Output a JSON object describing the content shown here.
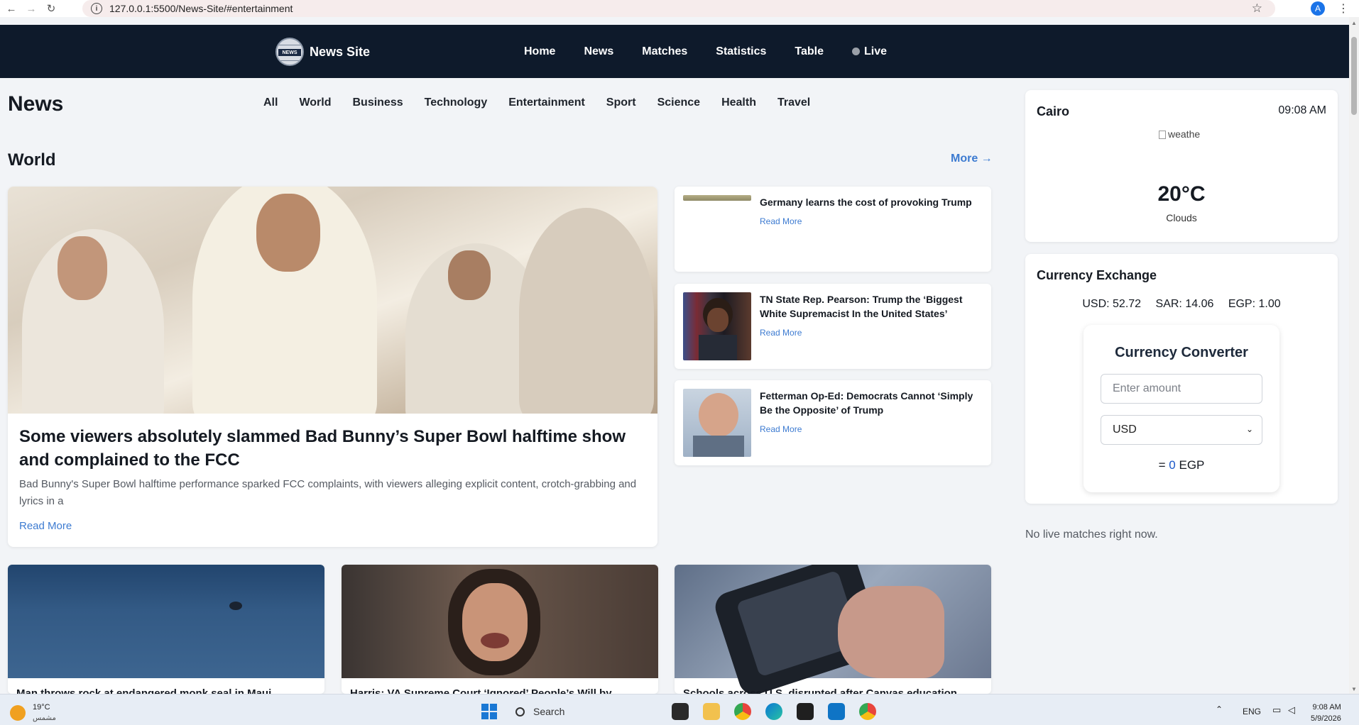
{
  "browser": {
    "url": "127.0.0.1:5500/News-Site/#entertainment",
    "profile_initial": "A"
  },
  "header": {
    "brand": "News Site",
    "logo_badge": "NEWS",
    "nav": [
      "Home",
      "News",
      "Matches",
      "Statistics",
      "Table",
      "Live"
    ]
  },
  "page": {
    "title": "News",
    "categories": [
      "All",
      "World",
      "Business",
      "Technology",
      "Entertainment",
      "Sport",
      "Science",
      "Health",
      "Travel"
    ],
    "section_title": "World",
    "more_label": "More →"
  },
  "featured": {
    "title": "Some viewers absolutely slammed Bad Bunny’s Super Bowl halftime show and complained to the FCC",
    "description": "Bad Bunny's Super Bowl halftime performance sparked FCC complaints, with viewers alleging explicit content, crotch-grabbing and lyrics in a",
    "read_more": "Read More"
  },
  "side_stories": [
    {
      "title": "Germany learns the cost of provoking Trump",
      "read_more": "Read More"
    },
    {
      "title": "TN State Rep. Pearson: Trump the ‘Biggest White Supremacist In the United States’",
      "read_more": "Read More"
    },
    {
      "title": "Fetterman Op-Ed: Democrats Cannot ‘Simply Be the Opposite’ of Trump",
      "read_more": "Read More"
    }
  ],
  "grid_stories": [
    {
      "title": "Man throws rock at endangered monk seal in Maui"
    },
    {
      "title": "Harris: VA Supreme Court ‘Ignored’ People’s Will by"
    },
    {
      "title": "Schools across U.S. disrupted after Canvas education"
    }
  ],
  "weather": {
    "city": "Cairo",
    "time": "09:08 AM",
    "icon_alt": "weathe",
    "temperature": "20°C",
    "condition": "Clouds"
  },
  "currency": {
    "title": "Currency Exchange",
    "rates": [
      "USD: 52.72",
      "SAR: 14.06",
      "EGP: 1.00"
    ],
    "converter": {
      "title": "Currency Converter",
      "amount_placeholder": "Enter amount",
      "selected_currency": "USD",
      "result_prefix": "=",
      "result_value": "0",
      "result_currency": "EGP"
    }
  },
  "live": {
    "message": "No live matches right now."
  },
  "taskbar": {
    "weather_temp": "19°C",
    "weather_label": "مشمس",
    "search_label": "Search",
    "language": "ENG",
    "time": "9:08 AM",
    "date": "5/9/2026"
  },
  "colors": {
    "header_bg": "#0e1a2b",
    "link": "#3d7bd1",
    "page_bg": "#f2f4f7"
  }
}
